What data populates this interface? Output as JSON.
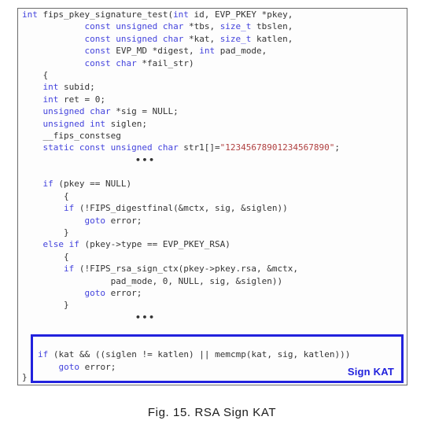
{
  "figure": {
    "caption": "Fig. 15. RSA Sign KAT",
    "language": "c",
    "colors": {
      "keyword": "#4444dd",
      "identifier": "#333333",
      "string": "#b04040",
      "highlight_border": "#2222dd",
      "highlight_label": "#2222dd",
      "frame_border": "#6b6b6b",
      "background": "#fdfdfd"
    }
  },
  "code": {
    "lines": [
      [
        {
          "t": "int",
          "c": "kw"
        },
        {
          "t": " fips_pkey_signature_test(",
          "c": "id"
        },
        {
          "t": "int",
          "c": "kw"
        },
        {
          "t": " id, EVP_PKEY *pkey,",
          "c": "id"
        }
      ],
      [
        {
          "t": "            ",
          "c": "id"
        },
        {
          "t": "const unsigned char",
          "c": "kw"
        },
        {
          "t": " *tbs, ",
          "c": "id"
        },
        {
          "t": "size_t",
          "c": "kw"
        },
        {
          "t": " tbslen,",
          "c": "id"
        }
      ],
      [
        {
          "t": "            ",
          "c": "id"
        },
        {
          "t": "const unsigned char",
          "c": "kw"
        },
        {
          "t": " *kat, ",
          "c": "id"
        },
        {
          "t": "size_t",
          "c": "kw"
        },
        {
          "t": " katlen,",
          "c": "id"
        }
      ],
      [
        {
          "t": "            ",
          "c": "id"
        },
        {
          "t": "const",
          "c": "kw"
        },
        {
          "t": " EVP_MD *digest, ",
          "c": "id"
        },
        {
          "t": "int",
          "c": "kw"
        },
        {
          "t": " pad_mode,",
          "c": "id"
        }
      ],
      [
        {
          "t": "            ",
          "c": "id"
        },
        {
          "t": "const char",
          "c": "kw"
        },
        {
          "t": " *fail_str)",
          "c": "id"
        }
      ],
      [
        {
          "t": "    {",
          "c": "id"
        }
      ],
      [
        {
          "t": "    ",
          "c": "id"
        },
        {
          "t": "int",
          "c": "kw"
        },
        {
          "t": " subid;",
          "c": "id"
        }
      ],
      [
        {
          "t": "    ",
          "c": "id"
        },
        {
          "t": "int",
          "c": "kw"
        },
        {
          "t": " ret = 0;",
          "c": "id"
        }
      ],
      [
        {
          "t": "    ",
          "c": "id"
        },
        {
          "t": "unsigned char",
          "c": "kw"
        },
        {
          "t": " *sig = NULL;",
          "c": "id"
        }
      ],
      [
        {
          "t": "    ",
          "c": "id"
        },
        {
          "t": "unsigned int",
          "c": "kw"
        },
        {
          "t": " siglen;",
          "c": "id"
        }
      ],
      [
        {
          "t": "    __fips_constseg",
          "c": "id"
        }
      ],
      [
        {
          "t": "    ",
          "c": "id"
        },
        {
          "t": "static const unsigned char",
          "c": "kw"
        },
        {
          "t": " str1[]=",
          "c": "id"
        },
        {
          "t": "\"12345678901234567890\"",
          "c": "str"
        },
        {
          "t": ";",
          "c": "id"
        }
      ],
      "ELLIPSIS",
      [
        {
          "t": "",
          "c": "id"
        }
      ],
      [
        {
          "t": "    ",
          "c": "id"
        },
        {
          "t": "if",
          "c": "kw"
        },
        {
          "t": " (pkey == NULL)",
          "c": "id"
        }
      ],
      [
        {
          "t": "        {",
          "c": "id"
        }
      ],
      [
        {
          "t": "        ",
          "c": "id"
        },
        {
          "t": "if",
          "c": "kw"
        },
        {
          "t": " (!FIPS_digestfinal(&mctx, sig, &siglen))",
          "c": "id"
        }
      ],
      [
        {
          "t": "            ",
          "c": "id"
        },
        {
          "t": "goto",
          "c": "kw"
        },
        {
          "t": " error;",
          "c": "id"
        }
      ],
      [
        {
          "t": "        }",
          "c": "id"
        }
      ],
      [
        {
          "t": "    ",
          "c": "id"
        },
        {
          "t": "else if",
          "c": "kw"
        },
        {
          "t": " (pkey->type == EVP_PKEY_RSA)",
          "c": "id"
        }
      ],
      [
        {
          "t": "        {",
          "c": "id"
        }
      ],
      [
        {
          "t": "        ",
          "c": "id"
        },
        {
          "t": "if",
          "c": "kw"
        },
        {
          "t": " (!FIPS_rsa_sign_ctx(pkey->pkey.rsa, &mctx,",
          "c": "id"
        }
      ],
      [
        {
          "t": "                 pad_mode, 0, NULL, sig, &siglen))",
          "c": "id"
        }
      ],
      [
        {
          "t": "            ",
          "c": "id"
        },
        {
          "t": "goto",
          "c": "kw"
        },
        {
          "t": " error;",
          "c": "id"
        }
      ],
      [
        {
          "t": "        }",
          "c": "id"
        }
      ],
      "ELLIPSIS"
    ],
    "ellipsis_glyph": "•••"
  },
  "highlight": {
    "label": "Sign KAT",
    "lines": [
      [
        {
          "t": "",
          "c": "id"
        }
      ],
      [
        {
          "t": "if",
          "c": "kw"
        },
        {
          "t": " (kat && ((siglen != katlen) || memcmp(kat, sig, katlen)))",
          "c": "id"
        }
      ],
      [
        {
          "t": "    ",
          "c": "id"
        },
        {
          "t": "goto",
          "c": "kw"
        },
        {
          "t": " error;",
          "c": "id"
        }
      ]
    ]
  },
  "trailing": {
    "closing_brace": "}"
  }
}
